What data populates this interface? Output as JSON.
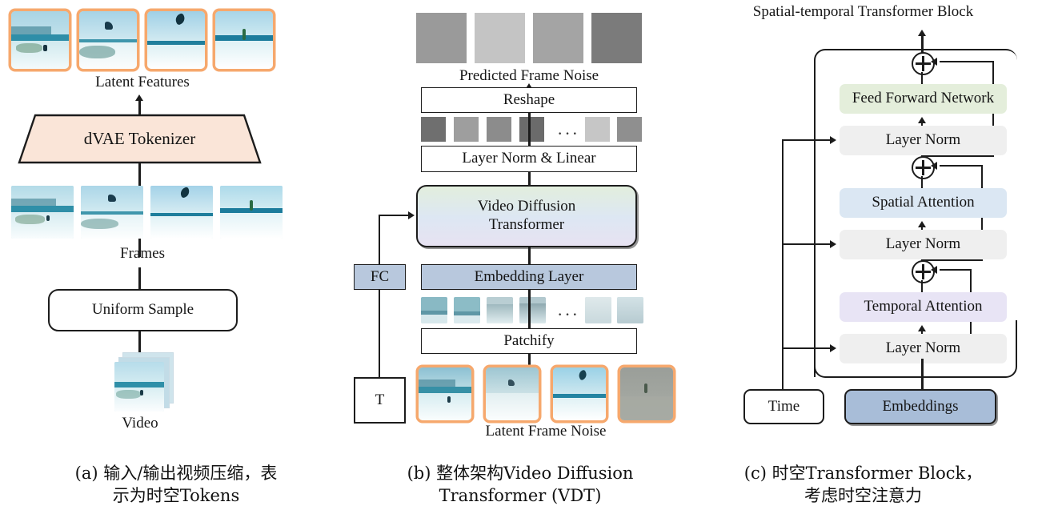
{
  "figure": {
    "title": "VDT: Video Diffusion Transformer architecture (3 panels)",
    "panels": [
      "a",
      "b",
      "c"
    ]
  },
  "colors": {
    "latent_frame_border": "#f6a86d",
    "dvae_fill": "#fae5d8",
    "vdt_gradient_top": "#e2eedd",
    "vdt_gradient_mid": "#dde7f3",
    "vdt_gradient_bottom": "#e7e2f2",
    "embedding_layer_fill": "#b8c8dd",
    "fc_fill": "#b8c8dd",
    "embeddings_fill": "#a8bdd8",
    "ffn_fill": "#e4eedb",
    "spatial_attention_fill": "#dbe7f3",
    "temporal_attention_fill": "#e8e4f5",
    "layer_norm_fill": "#efefef",
    "stroke": "#1c1c1c",
    "box_fill": "#ffffff"
  },
  "panel_a": {
    "nodes": {
      "latent_features_label": "Latent Features",
      "dvae_tokenizer": "dVAE Tokenizer",
      "frames_label": "Frames",
      "uniform_sample": "Uniform Sample",
      "video_label": "Video"
    },
    "latent_features_count": 4,
    "frames_count": 4,
    "caption_line1": "(a) 输入/输出视频压缩，表",
    "caption_line2": "示为时空Tokens"
  },
  "panel_b": {
    "nodes": {
      "predicted_frame_noise_label": "Predicted Frame Noise",
      "reshape": "Reshape",
      "layer_norm_linear": "Layer Norm & Linear",
      "video_diffusion_transformer_line1": "Video Diffusion",
      "video_diffusion_transformer_line2": "Transformer",
      "fc": "FC",
      "embedding_layer": "Embedding Layer",
      "patchify": "Patchify",
      "timestep": "T",
      "latent_frame_noise_label": "Latent Frame Noise"
    },
    "predicted_noise_tiles": [
      "#9a9a9a",
      "#c4c4c4",
      "#a4a4a4",
      "#7b7b7b"
    ],
    "token_tiles": [
      "#6f6f6f",
      "#9e9e9e",
      "#8c8c8c",
      "#6b6b6b",
      "#c6c6c6",
      "#8f8f8f"
    ],
    "token_ellipsis": "···",
    "patch_ellipsis": "···",
    "patch_count": 6,
    "latent_frame_noise_count": 4,
    "caption_line1": "(b) 整体架构Video Diffusion",
    "caption_line2": "Transformer (VDT)"
  },
  "panel_c": {
    "nodes": {
      "block_title": "Spatial-temporal Transformer Block",
      "feed_forward_network": "Feed Forward Network",
      "layer_norm_3": "Layer Norm",
      "spatial_attention": "Spatial Attention",
      "layer_norm_2": "Layer Norm",
      "temporal_attention": "Temporal Attention",
      "layer_norm_1": "Layer Norm",
      "time": "Time",
      "embeddings": "Embeddings"
    },
    "residual_adders": 3,
    "adder_symbol": "⊕",
    "caption_line1": "(c) 时空Transformer Block，",
    "caption_line2": "考虑时空注意力"
  }
}
